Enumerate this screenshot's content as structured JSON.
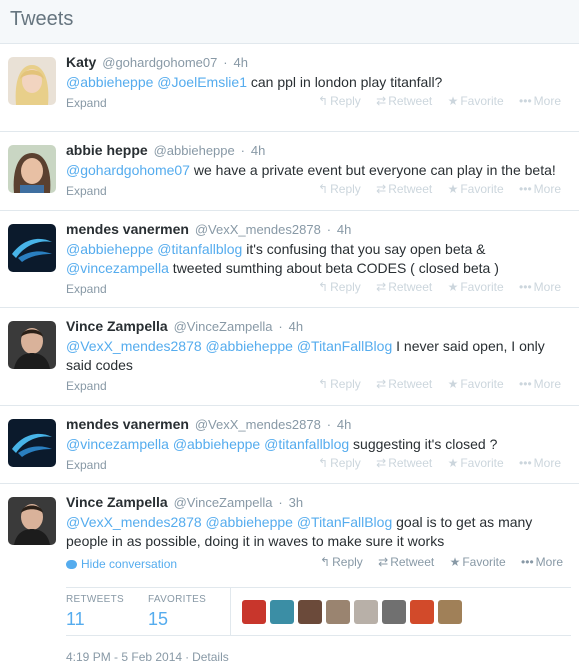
{
  "header": {
    "title": "Tweets"
  },
  "actions": {
    "reply": "Reply",
    "retweet": "Retweet",
    "favorite": "Favorite",
    "more": "More",
    "reply_icon": "reply-icon",
    "retweet_icon": "retweet-icon",
    "favorite_icon": "star-icon",
    "more_icon": "ellipsis-icon"
  },
  "tweets": [
    {
      "fullname": "Katy",
      "username": "@gohardgohome07",
      "time": "4h",
      "avatar": "blonde-woman-avatar",
      "text": [
        {
          "t": "@abbieheppe",
          "m": true
        },
        {
          "t": " ",
          "m": false
        },
        {
          "t": "@JoelEmslie1",
          "m": true
        },
        {
          "t": " can ppl in london play titanfall?",
          "m": false
        }
      ],
      "footer": "Expand"
    },
    {
      "fullname": "abbie heppe",
      "username": "@abbieheppe",
      "time": "4h",
      "avatar": "woman-selfie-avatar",
      "text": [
        {
          "t": "@gohardgohome07",
          "m": true
        },
        {
          "t": " we have a private event but everyone can play in the beta!",
          "m": false
        }
      ],
      "footer": "Expand"
    },
    {
      "fullname": "mendes vanermen",
      "username": "@VexX_mendes2878",
      "time": "4h",
      "avatar": "blue-swoosh-avatar",
      "text": [
        {
          "t": "@abbieheppe",
          "m": true
        },
        {
          "t": " ",
          "m": false
        },
        {
          "t": "@titanfallblog",
          "m": true
        },
        {
          "t": " it's confusing that you say open beta & ",
          "m": false
        },
        {
          "t": "@vincezampella",
          "m": true
        },
        {
          "t": " tweeted sumthing about beta CODES ( closed beta )",
          "m": false
        }
      ],
      "footer": "Expand"
    },
    {
      "fullname": "Vince Zampella",
      "username": "@VinceZampella",
      "time": "4h",
      "avatar": "man-portrait-avatar",
      "text": [
        {
          "t": "@VexX_mendes2878",
          "m": true
        },
        {
          "t": " ",
          "m": false
        },
        {
          "t": "@abbieheppe",
          "m": true
        },
        {
          "t": " ",
          "m": false
        },
        {
          "t": "@TitanFallBlog",
          "m": true
        },
        {
          "t": " I never said open, I only said codes",
          "m": false
        }
      ],
      "footer": "Expand"
    },
    {
      "fullname": "mendes vanermen",
      "username": "@VexX_mendes2878",
      "time": "4h",
      "avatar": "blue-swoosh-avatar",
      "text": [
        {
          "t": "@vincezampella",
          "m": true
        },
        {
          "t": " ",
          "m": false
        },
        {
          "t": "@abbieheppe",
          "m": true
        },
        {
          "t": " ",
          "m": false
        },
        {
          "t": "@titanfallblog",
          "m": true
        },
        {
          "t": " suggesting it's closed ?",
          "m": false
        }
      ],
      "footer": "Expand"
    }
  ],
  "focused": {
    "fullname": "Vince Zampella",
    "username": "@VinceZampella",
    "time": "3h",
    "avatar": "man-portrait-avatar",
    "text": [
      {
        "t": "@VexX_mendes2878",
        "m": true
      },
      {
        "t": " ",
        "m": false
      },
      {
        "t": "@abbieheppe",
        "m": true
      },
      {
        "t": " ",
        "m": false
      },
      {
        "t": "@TitanFallBlog",
        "m": true
      },
      {
        "t": " goal is to get as many people in as possible, doing it in waves to make sure it works",
        "m": false
      }
    ],
    "hide_conversation": "Hide conversation",
    "retweets_label": "RETWEETS",
    "retweets_count": "11",
    "favorites_label": "FAVORITES",
    "favorites_count": "15",
    "favoriters": [
      {
        "icon": "red-cap-avatar",
        "color": "#c8362c"
      },
      {
        "icon": "egg-avatar",
        "color": "#3b8ea5"
      },
      {
        "icon": "portrait-avatar",
        "color": "#6b4a3a"
      },
      {
        "icon": "portrait-avatar",
        "color": "#9a8470"
      },
      {
        "icon": "portrait-avatar",
        "color": "#b8b0a8"
      },
      {
        "icon": "portrait-avatar",
        "color": "#707070"
      },
      {
        "icon": "red-face-avatar",
        "color": "#d24a2a"
      },
      {
        "icon": "cat-avatar",
        "color": "#a08058"
      }
    ],
    "timestamp": "4:19 PM - 5 Feb 2014",
    "details": "Details"
  },
  "colors": {
    "link": "#55acee",
    "muted": "#8899a6",
    "border": "#e1e8ed"
  }
}
